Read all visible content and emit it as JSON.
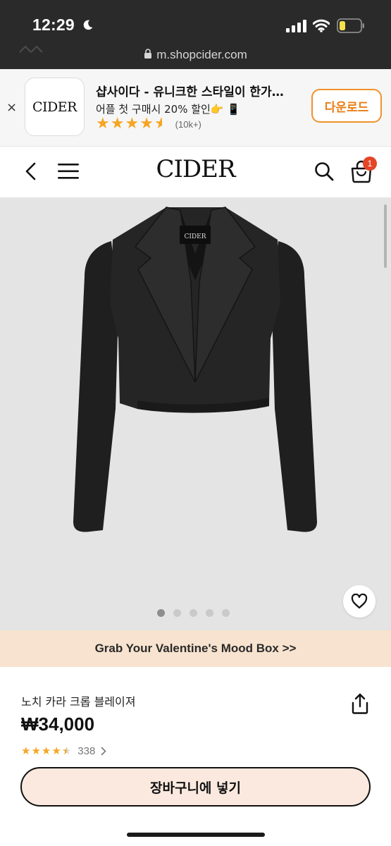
{
  "status_bar": {
    "time": "12:29",
    "icons": [
      "moon-icon",
      "signal-icon",
      "wifi-icon",
      "battery-low-icon"
    ],
    "battery_color": "#f6e04b"
  },
  "browser": {
    "url": "m.shopcider.com"
  },
  "app_banner": {
    "close_label": "×",
    "icon_text": "CIDER",
    "title": "샵사이다 - 유니크한 스타일이 한가…",
    "subtitle": "어플 첫 구매시 20% 할인👉 📱",
    "stars": "★★★★★",
    "rating_count": "(10k+)",
    "download_label": "다운로드",
    "accent_color": "#f0922b"
  },
  "header": {
    "brand": "CIDER",
    "cart_count": "1",
    "badge_color": "#e54427"
  },
  "product_image": {
    "background": "#e4e4e4",
    "garment_label": "CIDER",
    "slide_count": 5,
    "active_slide": 1
  },
  "promo": {
    "text": "Grab Your Valentine's Mood Box >>",
    "background": "#f7e3cf"
  },
  "product": {
    "name": "노치 카라 크롭 블레이져",
    "price": "₩34,000",
    "rating_stars": "★★★★★",
    "rating_value": 4.5,
    "review_count": "338",
    "add_to_cart_label": "장바구니에 넣기",
    "button_color": "#fbe9df"
  }
}
